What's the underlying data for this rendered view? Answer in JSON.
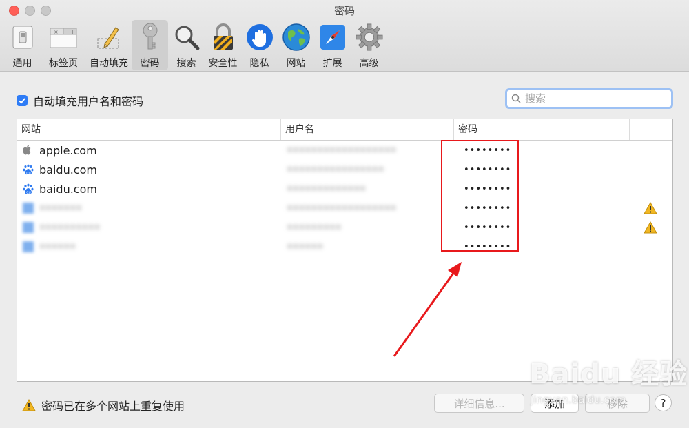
{
  "window": {
    "title": "密码"
  },
  "toolbar": {
    "items": [
      {
        "label": "通用",
        "icon": "switch-icon"
      },
      {
        "label": "标签页",
        "icon": "tabs-icon"
      },
      {
        "label": "自动填充",
        "icon": "pencil-icon"
      },
      {
        "label": "密码",
        "icon": "key-icon",
        "active": true
      },
      {
        "label": "搜索",
        "icon": "magnifier-icon"
      },
      {
        "label": "安全性",
        "icon": "lock-icon"
      },
      {
        "label": "隐私",
        "icon": "hand-icon"
      },
      {
        "label": "网站",
        "icon": "globe-icon"
      },
      {
        "label": "扩展",
        "icon": "puzzle-icon"
      },
      {
        "label": "高级",
        "icon": "gear-icon"
      }
    ]
  },
  "autofill": {
    "label": "自动填充用户名和密码",
    "checked": true
  },
  "search": {
    "placeholder": "搜索"
  },
  "table": {
    "columns": [
      "网站",
      "用户名",
      "密码"
    ],
    "rows": [
      {
        "site": "apple.com",
        "icon": "apple-icon",
        "user": "••••••••••••••••••",
        "password": "••••••••",
        "warning": false
      },
      {
        "site": "baidu.com",
        "icon": "baidu-paw-icon",
        "user": "••••••••••••••••",
        "password": "••••••••",
        "warning": false
      },
      {
        "site": "baidu.com",
        "icon": "baidu-paw-icon",
        "user": "•••••••••••••",
        "password": "••••••••",
        "warning": false
      },
      {
        "site": "•••••••",
        "icon": "blurred-icon",
        "user": "••••••••••••••••••",
        "password": "••••••••",
        "warning": true
      },
      {
        "site": "••••••••••",
        "icon": "blurred-icon",
        "user": "•••••••••",
        "password": "••••••••",
        "warning": true
      },
      {
        "site": "••••••",
        "icon": "blurred-icon",
        "user": "••••••",
        "password": "••••••••",
        "warning": false
      }
    ]
  },
  "footer": {
    "warning_text": "密码已在多个网站上重复使用",
    "details_label": "详细信息...",
    "add_label": "添加",
    "remove_label": "移除",
    "help_label": "?"
  },
  "watermark": {
    "brand": "Baidu 经验",
    "url": "jingyan.baidu.com"
  },
  "colors": {
    "accent": "#2e7cf6",
    "highlight": "#e8191c",
    "warning": "#f1b722"
  }
}
